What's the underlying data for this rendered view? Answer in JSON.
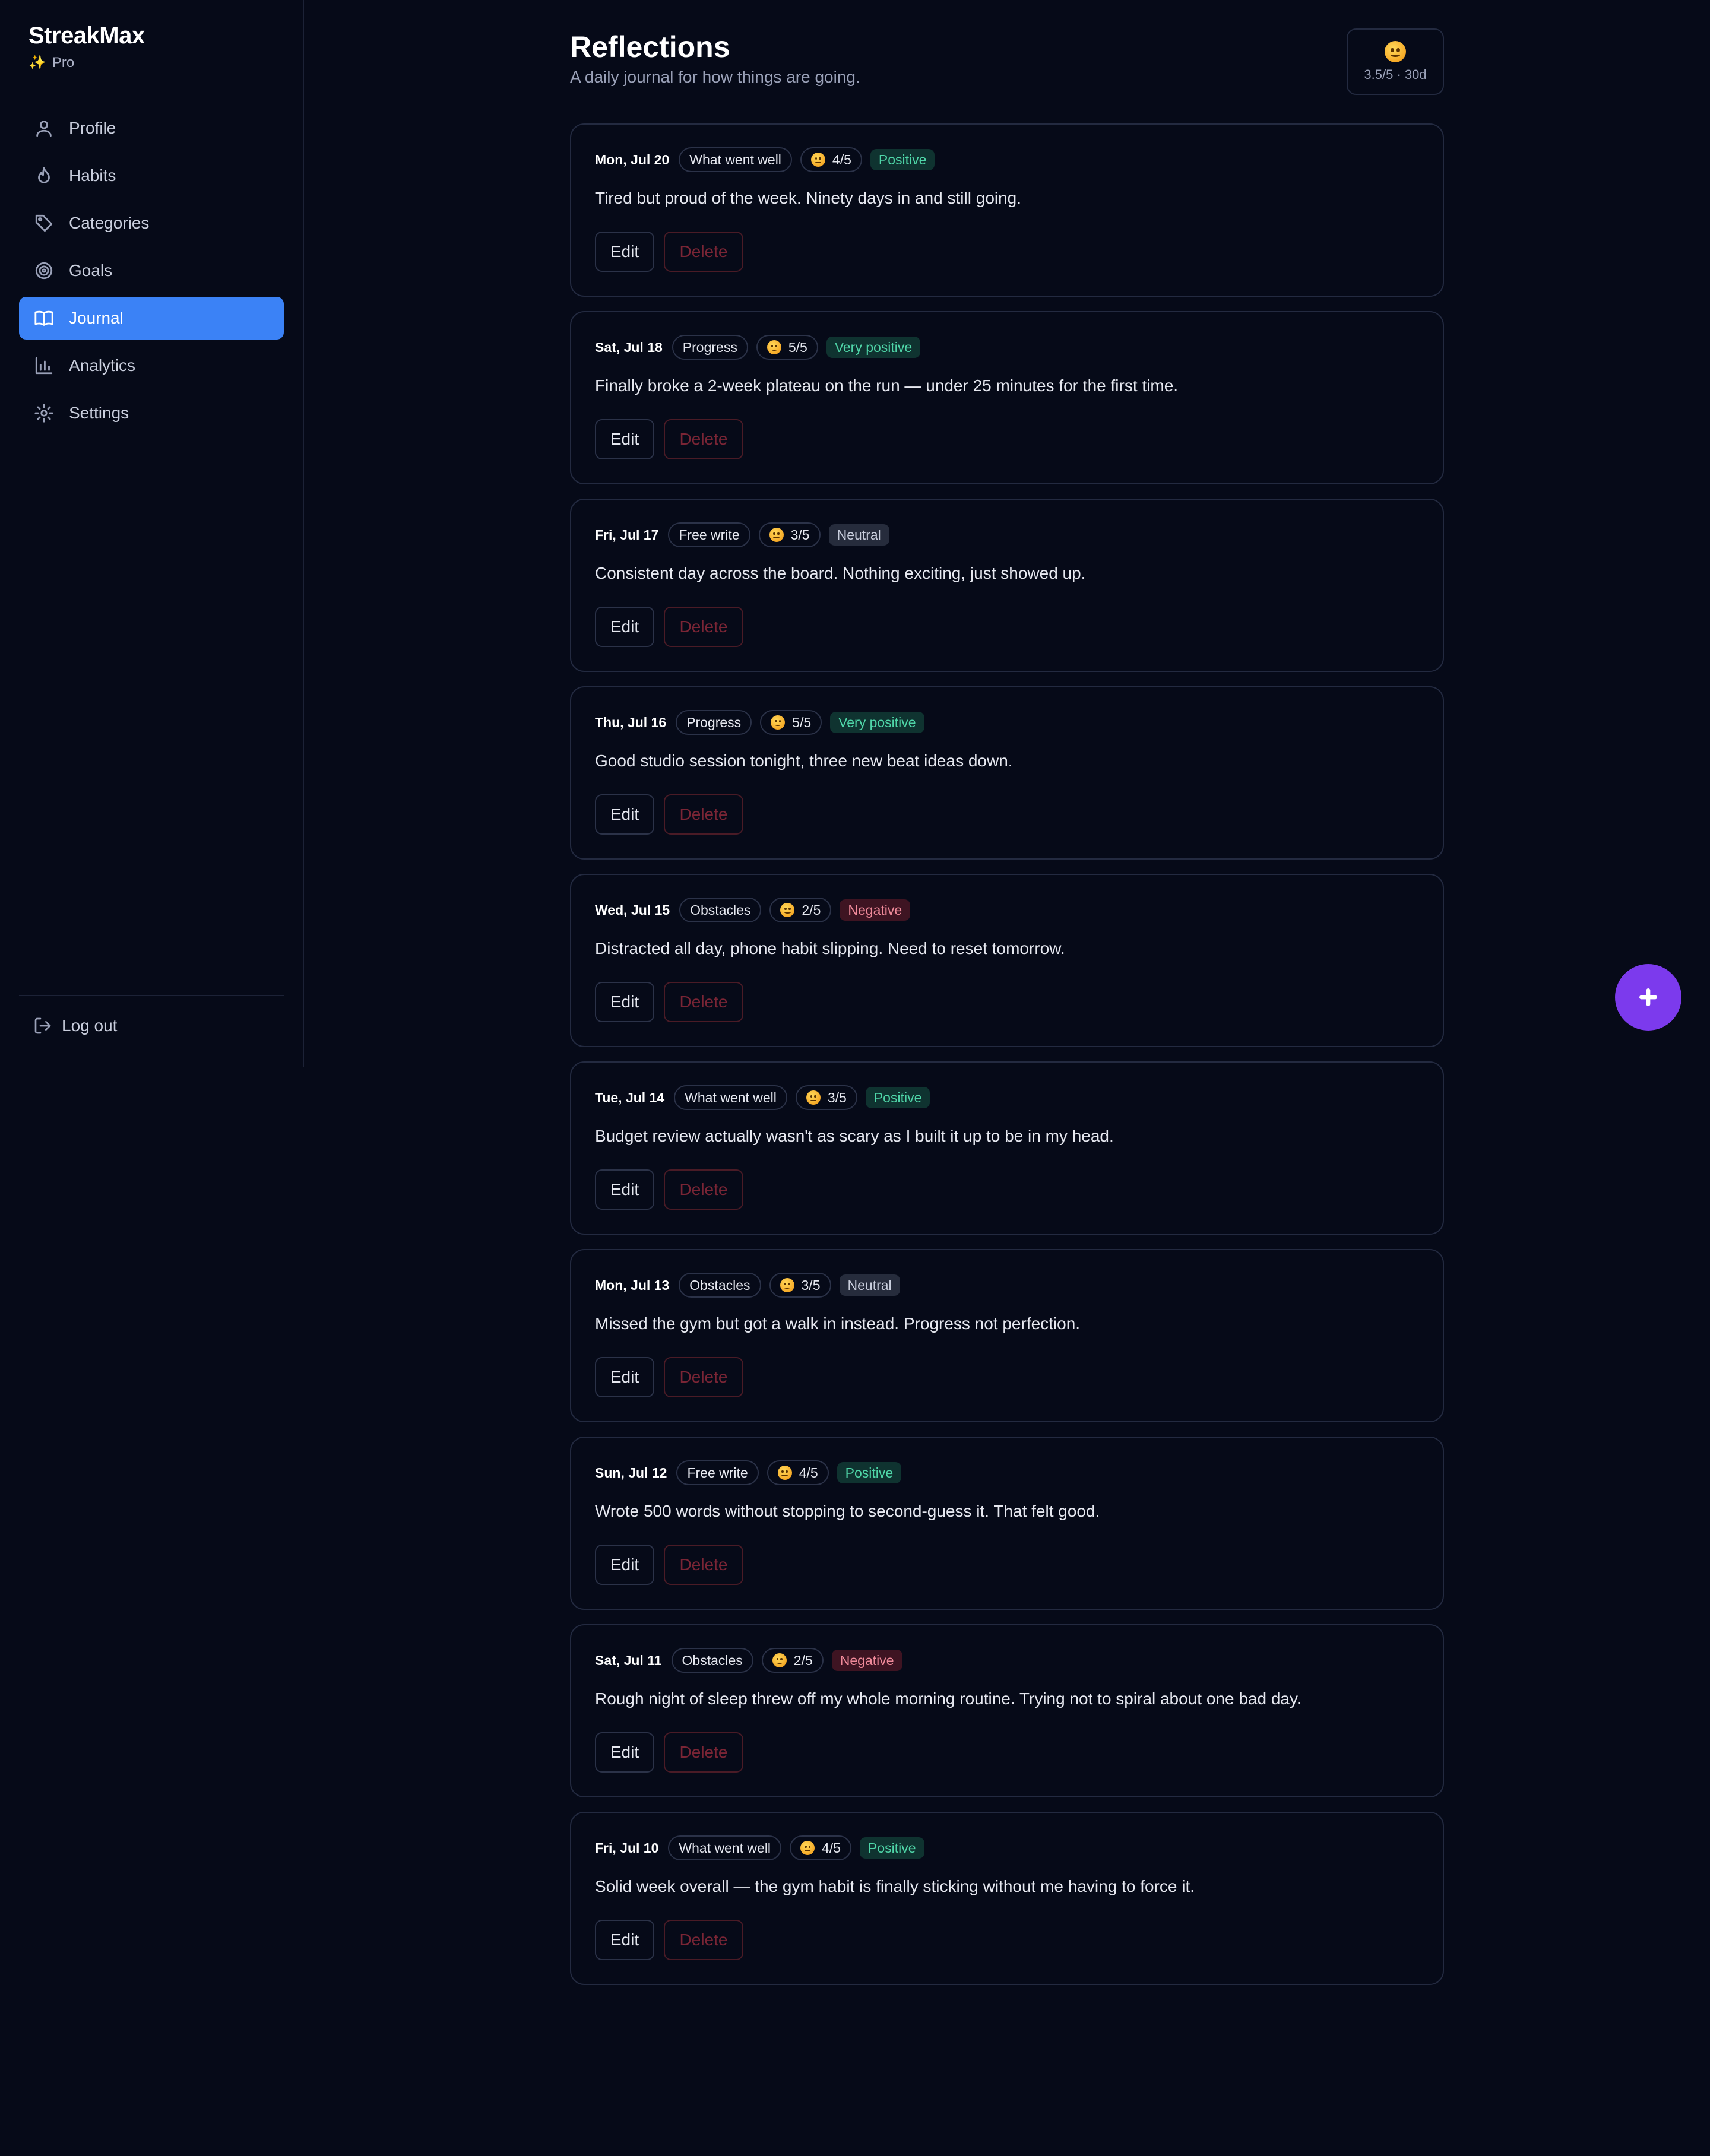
{
  "app": {
    "name": "StreakMax",
    "tier": "Pro"
  },
  "sidebar": {
    "items": [
      {
        "label": "Profile",
        "icon": "user-icon"
      },
      {
        "label": "Habits",
        "icon": "flame-icon"
      },
      {
        "label": "Categories",
        "icon": "tag-icon"
      },
      {
        "label": "Goals",
        "icon": "target-icon"
      },
      {
        "label": "Journal",
        "icon": "book-icon",
        "active": true
      },
      {
        "label": "Analytics",
        "icon": "bar-chart-icon"
      },
      {
        "label": "Settings",
        "icon": "gear-icon"
      }
    ],
    "logout_label": "Log out"
  },
  "header": {
    "title": "Reflections",
    "subtitle": "A daily journal for how things are going.",
    "mood_summary": "3.5/5 · 30d"
  },
  "entries": [
    {
      "date": "Mon, Jul 20",
      "prompt": "What went well",
      "mood": "4/5",
      "sentiment": "Positive",
      "sentiment_type": "positive",
      "text": "Tired but proud of the week. Ninety days in and still going."
    },
    {
      "date": "Sat, Jul 18",
      "prompt": "Progress",
      "mood": "5/5",
      "sentiment": "Very positive",
      "sentiment_type": "positive",
      "text": "Finally broke a 2-week plateau on the run — under 25 minutes for the first time."
    },
    {
      "date": "Fri, Jul 17",
      "prompt": "Free write",
      "mood": "3/5",
      "sentiment": "Neutral",
      "sentiment_type": "neutral",
      "text": "Consistent day across the board. Nothing exciting, just showed up."
    },
    {
      "date": "Thu, Jul 16",
      "prompt": "Progress",
      "mood": "5/5",
      "sentiment": "Very positive",
      "sentiment_type": "positive",
      "text": "Good studio session tonight, three new beat ideas down."
    },
    {
      "date": "Wed, Jul 15",
      "prompt": "Obstacles",
      "mood": "2/5",
      "sentiment": "Negative",
      "sentiment_type": "negative",
      "text": "Distracted all day, phone habit slipping. Need to reset tomorrow."
    },
    {
      "date": "Tue, Jul 14",
      "prompt": "What went well",
      "mood": "3/5",
      "sentiment": "Positive",
      "sentiment_type": "positive",
      "text": "Budget review actually wasn't as scary as I built it up to be in my head."
    },
    {
      "date": "Mon, Jul 13",
      "prompt": "Obstacles",
      "mood": "3/5",
      "sentiment": "Neutral",
      "sentiment_type": "neutral",
      "text": "Missed the gym but got a walk in instead. Progress not perfection."
    },
    {
      "date": "Sun, Jul 12",
      "prompt": "Free write",
      "mood": "4/5",
      "sentiment": "Positive",
      "sentiment_type": "positive",
      "text": "Wrote 500 words without stopping to second-guess it. That felt good."
    },
    {
      "date": "Sat, Jul 11",
      "prompt": "Obstacles",
      "mood": "2/5",
      "sentiment": "Negative",
      "sentiment_type": "negative",
      "text": "Rough night of sleep threw off my whole morning routine. Trying not to spiral about one bad day."
    },
    {
      "date": "Fri, Jul 10",
      "prompt": "What went well",
      "mood": "4/5",
      "sentiment": "Positive",
      "sentiment_type": "positive",
      "text": "Solid week overall — the gym habit is finally sticking without me having to force it."
    }
  ],
  "actions": {
    "edit_label": "Edit",
    "delete_label": "Delete"
  },
  "fab": {
    "icon": "plus-icon"
  },
  "colors": {
    "accent": "#3b82f6",
    "fab": "#7c3aed",
    "background": "#060a18"
  }
}
